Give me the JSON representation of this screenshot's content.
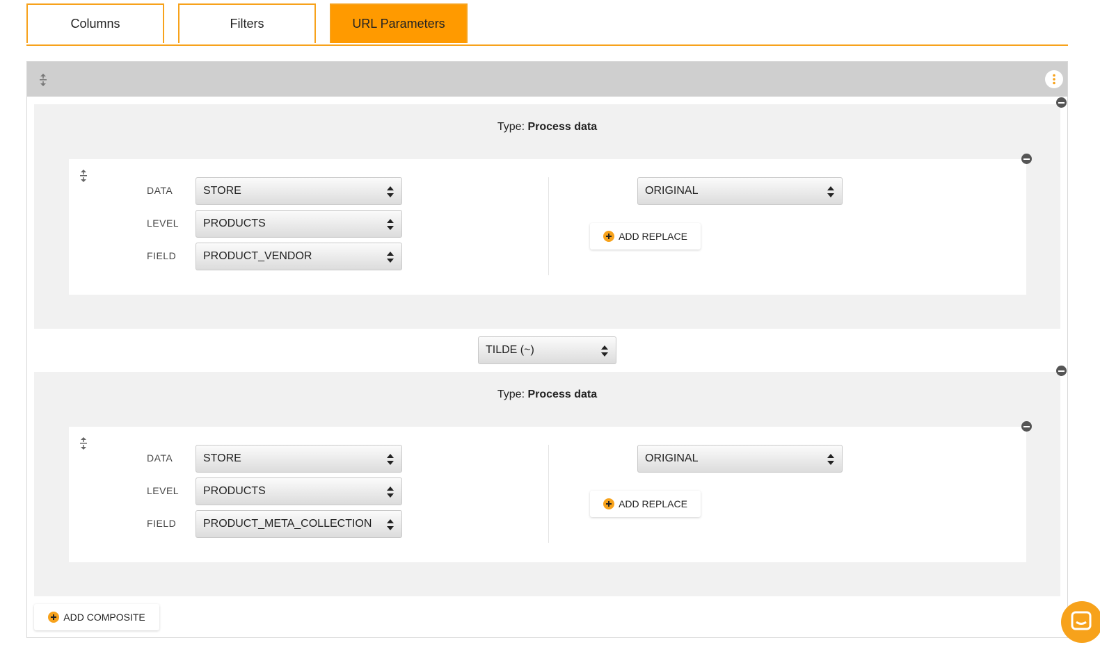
{
  "colors": {
    "accent": "#f7a21b",
    "active_tab": "#ff9a00",
    "header_bg": "#cfcfcf",
    "block_bg": "#f1f1f1"
  },
  "tabs": [
    {
      "label": "Columns",
      "active": false
    },
    {
      "label": "Filters",
      "active": false
    },
    {
      "label": "URL Parameters",
      "active": true
    }
  ],
  "composites": [
    {
      "type_prefix": "Type:",
      "type_value": "Process data",
      "fields": {
        "data_label": "DATA",
        "data_value": "STORE",
        "level_label": "LEVEL",
        "level_value": "PRODUCTS",
        "field_label": "FIELD",
        "field_value": "PRODUCT_VENDOR"
      },
      "transform_value": "ORIGINAL",
      "add_replace_label": "ADD REPLACE"
    },
    {
      "type_prefix": "Type:",
      "type_value": "Process data",
      "fields": {
        "data_label": "DATA",
        "data_value": "STORE",
        "level_label": "LEVEL",
        "level_value": "PRODUCTS",
        "field_label": "FIELD",
        "field_value": "PRODUCT_META_COLLECTION"
      },
      "transform_value": "ORIGINAL",
      "add_replace_label": "ADD REPLACE"
    }
  ],
  "separator_value": "TILDE (~)",
  "add_composite_label": "ADD COMPOSITE",
  "icons": [
    "drag-handle-icon",
    "kebab-menu-icon",
    "remove-icon",
    "select-arrows-icon",
    "plus-circle-icon",
    "chat-icon"
  ]
}
